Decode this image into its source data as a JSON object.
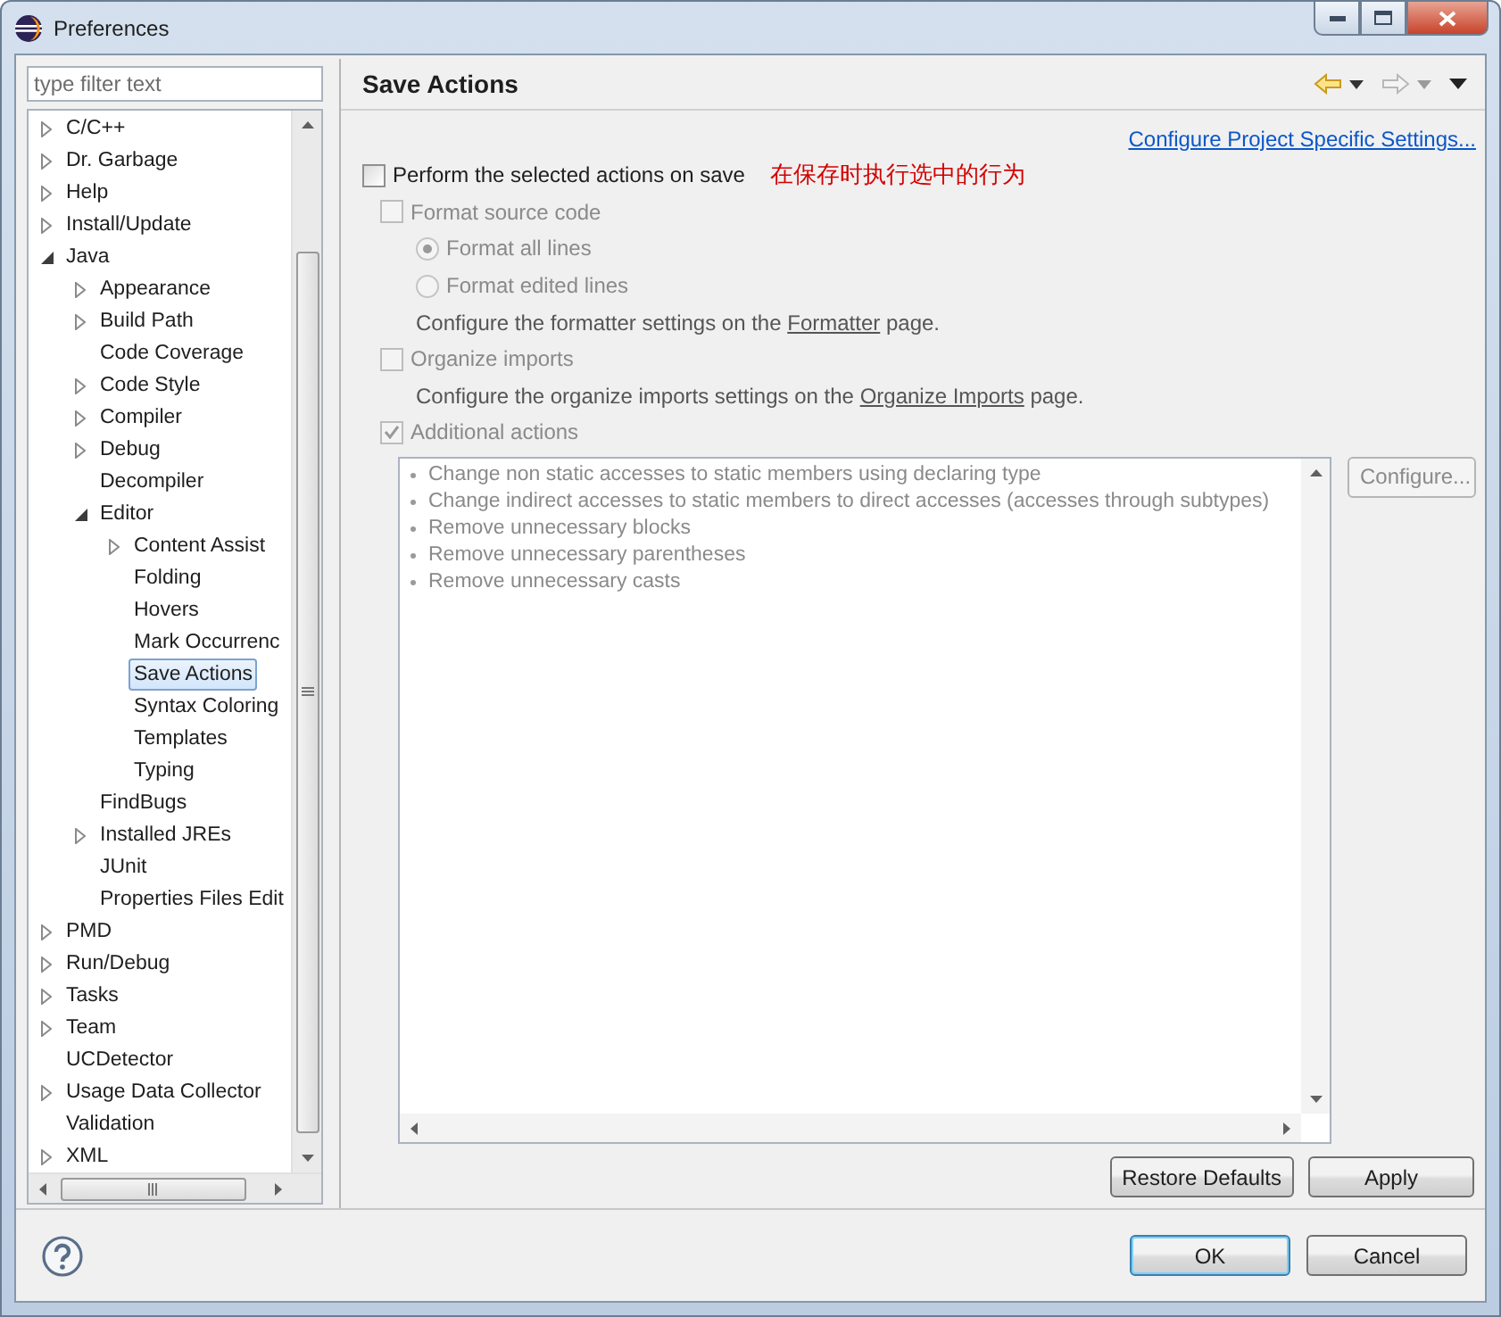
{
  "window": {
    "title": "Preferences"
  },
  "filter": {
    "placeholder": "type filter text"
  },
  "tree": [
    {
      "label": "C/C++",
      "kind": "node",
      "expanded": false,
      "selected": false
    },
    {
      "label": "Dr. Garbage",
      "kind": "node",
      "expanded": false,
      "selected": false
    },
    {
      "label": "Help",
      "kind": "node",
      "expanded": false,
      "selected": false
    },
    {
      "label": "Install/Update",
      "kind": "node",
      "expanded": false,
      "selected": false
    },
    {
      "label": "Java",
      "kind": "node",
      "expanded": true,
      "selected": false,
      "children": [
        {
          "label": "Appearance",
          "kind": "node",
          "expanded": false,
          "selected": false
        },
        {
          "label": "Build Path",
          "kind": "node",
          "expanded": false,
          "selected": false
        },
        {
          "label": "Code Coverage",
          "kind": "leaf",
          "selected": false
        },
        {
          "label": "Code Style",
          "kind": "node",
          "expanded": false,
          "selected": false
        },
        {
          "label": "Compiler",
          "kind": "node",
          "expanded": false,
          "selected": false
        },
        {
          "label": "Debug",
          "kind": "node",
          "expanded": false,
          "selected": false
        },
        {
          "label": "Decompiler",
          "kind": "leaf",
          "selected": false
        },
        {
          "label": "Editor",
          "kind": "node",
          "expanded": true,
          "selected": false,
          "children": [
            {
              "label": "Content Assist",
              "kind": "node",
              "expanded": false,
              "selected": false
            },
            {
              "label": "Folding",
              "kind": "leaf",
              "selected": false
            },
            {
              "label": "Hovers",
              "kind": "leaf",
              "selected": false
            },
            {
              "label": "Mark Occurrenc",
              "kind": "leaf",
              "selected": false
            },
            {
              "label": "Save Actions",
              "kind": "leaf",
              "selected": true
            },
            {
              "label": "Syntax Coloring",
              "kind": "leaf",
              "selected": false
            },
            {
              "label": "Templates",
              "kind": "leaf",
              "selected": false
            },
            {
              "label": "Typing",
              "kind": "leaf",
              "selected": false
            }
          ]
        },
        {
          "label": "FindBugs",
          "kind": "leaf",
          "selected": false
        },
        {
          "label": "Installed JREs",
          "kind": "node",
          "expanded": false,
          "selected": false
        },
        {
          "label": "JUnit",
          "kind": "leaf",
          "selected": false
        },
        {
          "label": "Properties Files Edit",
          "kind": "leaf",
          "selected": false
        }
      ]
    },
    {
      "label": "PMD",
      "kind": "node",
      "expanded": false,
      "selected": false
    },
    {
      "label": "Run/Debug",
      "kind": "node",
      "expanded": false,
      "selected": false
    },
    {
      "label": "Tasks",
      "kind": "node",
      "expanded": false,
      "selected": false
    },
    {
      "label": "Team",
      "kind": "node",
      "expanded": false,
      "selected": false
    },
    {
      "label": "UCDetector",
      "kind": "leaf",
      "selected": false
    },
    {
      "label": "Usage Data Collector",
      "kind": "node",
      "expanded": false,
      "selected": false
    },
    {
      "label": "Validation",
      "kind": "leaf",
      "selected": false
    },
    {
      "label": "XML",
      "kind": "node",
      "expanded": false,
      "selected": false
    }
  ],
  "page": {
    "title": "Save Actions",
    "link": "Configure Project Specific Settings...",
    "options": [
      {
        "kind": "checkbox",
        "label": "Perform the selected actions on save",
        "annotation": "在保存时执行选中的行为",
        "checked": false,
        "disabled": false,
        "children": [
          {
            "kind": "checkbox",
            "label": "Format source code",
            "checked": false,
            "disabled": true,
            "children": [
              {
                "kind": "radio",
                "label": "Format all lines",
                "selected": true,
                "disabled": true
              },
              {
                "kind": "radio",
                "label": "Format edited lines",
                "selected": false,
                "disabled": true
              },
              {
                "kind": "text",
                "before": "Configure the formatter settings on the ",
                "link": "Formatter",
                "after": " page."
              }
            ]
          },
          {
            "kind": "checkbox",
            "label": "Organize imports",
            "checked": false,
            "disabled": true,
            "children": [
              {
                "kind": "text",
                "before": "Configure the organize imports settings on the ",
                "link": "Organize Imports",
                "after": " page."
              }
            ]
          },
          {
            "kind": "checkbox",
            "label": "Additional actions",
            "checked": true,
            "disabled": true,
            "children": [
              {
                "kind": "list",
                "items": [
                  "Change non static accesses to static members using declaring type",
                  "Change indirect accesses to static members to direct accesses (accesses through subtypes)",
                  "Remove unnecessary blocks",
                  "Remove unnecessary parentheses",
                  "Remove unnecessary casts"
                ],
                "button": {
                  "label": "Configure...",
                  "disabled": true
                }
              }
            ]
          }
        ]
      }
    ],
    "buttons": [
      "Restore Defaults",
      "Apply"
    ]
  },
  "dialog_buttons": [
    {
      "label": "OK",
      "default": true
    },
    {
      "label": "Cancel",
      "default": false
    }
  ]
}
